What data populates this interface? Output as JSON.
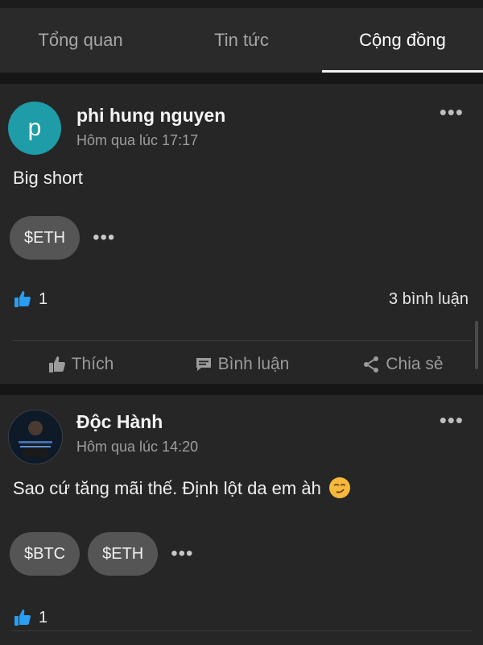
{
  "tabs": [
    {
      "label": "Tổng quan",
      "active": false
    },
    {
      "label": "Tin tức",
      "active": false
    },
    {
      "label": "Cộng đồng",
      "active": true
    }
  ],
  "posts": [
    {
      "avatar_letter": "p",
      "avatar_color": "#1e9ca8",
      "author": "phi hung nguyen",
      "time": "Hôm qua lúc 17:17",
      "text": "Big short",
      "tickers": [
        "$ETH"
      ],
      "likes": "1",
      "comments": "3 bình luận"
    },
    {
      "avatar_icon": "profile-photo",
      "author": "Độc Hành",
      "time": "Hôm qua lúc 14:20",
      "text": "Sao cứ tăng mãi thế. Định lột da em àh",
      "emoji": "smirk-emoji",
      "tickers": [
        "$BTC",
        "$ETH"
      ],
      "likes": "1"
    }
  ],
  "actions": {
    "like_label": "Thích",
    "comment_label": "Bình luận",
    "share_label": "Chia sẻ"
  },
  "more_symbol": "•••",
  "colors": {
    "like_blue": "#2a9df4",
    "avatar_teal": "#1e9ca8",
    "chip_bg": "#555555"
  }
}
